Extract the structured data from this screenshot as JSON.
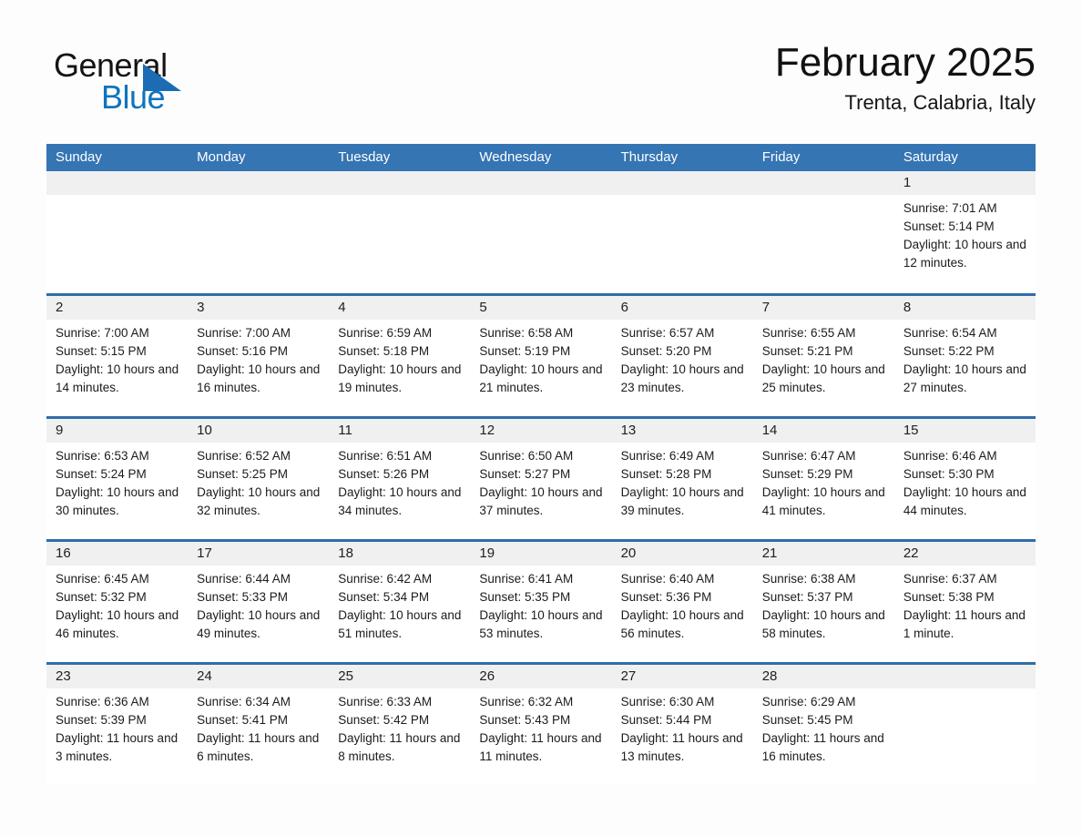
{
  "brand": {
    "name_part1": "General",
    "name_part2": "Blue"
  },
  "header": {
    "title": "February 2025",
    "subtitle": "Trenta, Calabria, Italy"
  },
  "colors": {
    "header_blue": "#3575b4",
    "row_divider_blue": "#2e6da9",
    "day_band_gray": "#f0f0f0",
    "brand_blue": "#1073bd",
    "text": "#1b1b1b"
  },
  "weekdays": [
    "Sunday",
    "Monday",
    "Tuesday",
    "Wednesday",
    "Thursday",
    "Friday",
    "Saturday"
  ],
  "weeks": [
    [
      {
        "day": "",
        "sunrise": "",
        "sunset": "",
        "daylight": ""
      },
      {
        "day": "",
        "sunrise": "",
        "sunset": "",
        "daylight": ""
      },
      {
        "day": "",
        "sunrise": "",
        "sunset": "",
        "daylight": ""
      },
      {
        "day": "",
        "sunrise": "",
        "sunset": "",
        "daylight": ""
      },
      {
        "day": "",
        "sunrise": "",
        "sunset": "",
        "daylight": ""
      },
      {
        "day": "",
        "sunrise": "",
        "sunset": "",
        "daylight": ""
      },
      {
        "day": "1",
        "sunrise": "Sunrise: 7:01 AM",
        "sunset": "Sunset: 5:14 PM",
        "daylight": "Daylight: 10 hours and 12 minutes."
      }
    ],
    [
      {
        "day": "2",
        "sunrise": "Sunrise: 7:00 AM",
        "sunset": "Sunset: 5:15 PM",
        "daylight": "Daylight: 10 hours and 14 minutes."
      },
      {
        "day": "3",
        "sunrise": "Sunrise: 7:00 AM",
        "sunset": "Sunset: 5:16 PM",
        "daylight": "Daylight: 10 hours and 16 minutes."
      },
      {
        "day": "4",
        "sunrise": "Sunrise: 6:59 AM",
        "sunset": "Sunset: 5:18 PM",
        "daylight": "Daylight: 10 hours and 19 minutes."
      },
      {
        "day": "5",
        "sunrise": "Sunrise: 6:58 AM",
        "sunset": "Sunset: 5:19 PM",
        "daylight": "Daylight: 10 hours and 21 minutes."
      },
      {
        "day": "6",
        "sunrise": "Sunrise: 6:57 AM",
        "sunset": "Sunset: 5:20 PM",
        "daylight": "Daylight: 10 hours and 23 minutes."
      },
      {
        "day": "7",
        "sunrise": "Sunrise: 6:55 AM",
        "sunset": "Sunset: 5:21 PM",
        "daylight": "Daylight: 10 hours and 25 minutes."
      },
      {
        "day": "8",
        "sunrise": "Sunrise: 6:54 AM",
        "sunset": "Sunset: 5:22 PM",
        "daylight": "Daylight: 10 hours and 27 minutes."
      }
    ],
    [
      {
        "day": "9",
        "sunrise": "Sunrise: 6:53 AM",
        "sunset": "Sunset: 5:24 PM",
        "daylight": "Daylight: 10 hours and 30 minutes."
      },
      {
        "day": "10",
        "sunrise": "Sunrise: 6:52 AM",
        "sunset": "Sunset: 5:25 PM",
        "daylight": "Daylight: 10 hours and 32 minutes."
      },
      {
        "day": "11",
        "sunrise": "Sunrise: 6:51 AM",
        "sunset": "Sunset: 5:26 PM",
        "daylight": "Daylight: 10 hours and 34 minutes."
      },
      {
        "day": "12",
        "sunrise": "Sunrise: 6:50 AM",
        "sunset": "Sunset: 5:27 PM",
        "daylight": "Daylight: 10 hours and 37 minutes."
      },
      {
        "day": "13",
        "sunrise": "Sunrise: 6:49 AM",
        "sunset": "Sunset: 5:28 PM",
        "daylight": "Daylight: 10 hours and 39 minutes."
      },
      {
        "day": "14",
        "sunrise": "Sunrise: 6:47 AM",
        "sunset": "Sunset: 5:29 PM",
        "daylight": "Daylight: 10 hours and 41 minutes."
      },
      {
        "day": "15",
        "sunrise": "Sunrise: 6:46 AM",
        "sunset": "Sunset: 5:30 PM",
        "daylight": "Daylight: 10 hours and 44 minutes."
      }
    ],
    [
      {
        "day": "16",
        "sunrise": "Sunrise: 6:45 AM",
        "sunset": "Sunset: 5:32 PM",
        "daylight": "Daylight: 10 hours and 46 minutes."
      },
      {
        "day": "17",
        "sunrise": "Sunrise: 6:44 AM",
        "sunset": "Sunset: 5:33 PM",
        "daylight": "Daylight: 10 hours and 49 minutes."
      },
      {
        "day": "18",
        "sunrise": "Sunrise: 6:42 AM",
        "sunset": "Sunset: 5:34 PM",
        "daylight": "Daylight: 10 hours and 51 minutes."
      },
      {
        "day": "19",
        "sunrise": "Sunrise: 6:41 AM",
        "sunset": "Sunset: 5:35 PM",
        "daylight": "Daylight: 10 hours and 53 minutes."
      },
      {
        "day": "20",
        "sunrise": "Sunrise: 6:40 AM",
        "sunset": "Sunset: 5:36 PM",
        "daylight": "Daylight: 10 hours and 56 minutes."
      },
      {
        "day": "21",
        "sunrise": "Sunrise: 6:38 AM",
        "sunset": "Sunset: 5:37 PM",
        "daylight": "Daylight: 10 hours and 58 minutes."
      },
      {
        "day": "22",
        "sunrise": "Sunrise: 6:37 AM",
        "sunset": "Sunset: 5:38 PM",
        "daylight": "Daylight: 11 hours and 1 minute."
      }
    ],
    [
      {
        "day": "23",
        "sunrise": "Sunrise: 6:36 AM",
        "sunset": "Sunset: 5:39 PM",
        "daylight": "Daylight: 11 hours and 3 minutes."
      },
      {
        "day": "24",
        "sunrise": "Sunrise: 6:34 AM",
        "sunset": "Sunset: 5:41 PM",
        "daylight": "Daylight: 11 hours and 6 minutes."
      },
      {
        "day": "25",
        "sunrise": "Sunrise: 6:33 AM",
        "sunset": "Sunset: 5:42 PM",
        "daylight": "Daylight: 11 hours and 8 minutes."
      },
      {
        "day": "26",
        "sunrise": "Sunrise: 6:32 AM",
        "sunset": "Sunset: 5:43 PM",
        "daylight": "Daylight: 11 hours and 11 minutes."
      },
      {
        "day": "27",
        "sunrise": "Sunrise: 6:30 AM",
        "sunset": "Sunset: 5:44 PM",
        "daylight": "Daylight: 11 hours and 13 minutes."
      },
      {
        "day": "28",
        "sunrise": "Sunrise: 6:29 AM",
        "sunset": "Sunset: 5:45 PM",
        "daylight": "Daylight: 11 hours and 16 minutes."
      },
      {
        "day": "",
        "sunrise": "",
        "sunset": "",
        "daylight": ""
      }
    ]
  ]
}
